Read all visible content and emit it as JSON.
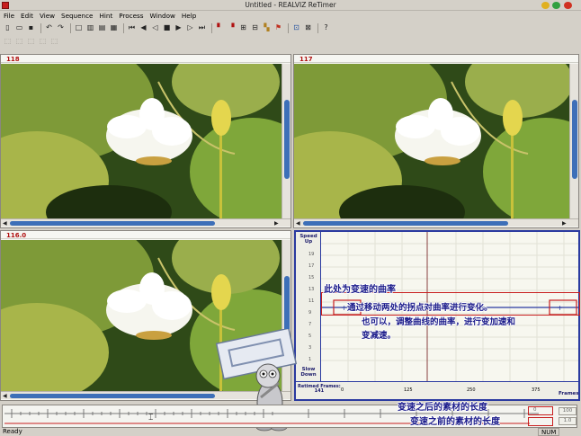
{
  "window": {
    "title": "Untitled - REALVIZ ReTimer"
  },
  "menu": [
    "File",
    "Edit",
    "View",
    "Sequence",
    "Hint",
    "Process",
    "Window",
    "Help"
  ],
  "panes": {
    "top_left": {
      "frame": "118"
    },
    "top_right": {
      "frame": "117"
    },
    "bottom_left": {
      "frame": "116.0"
    }
  },
  "graph": {
    "speed_up": "Speed Up",
    "slow_down": "Slow Down",
    "retimed_frames_label": "Retimed Frames:",
    "retimed_frames_value": "141",
    "frames_label": "Frames",
    "y_ticks": [
      "19",
      "17",
      "15",
      "13",
      "11",
      "9",
      "7",
      "5",
      "3",
      "1"
    ],
    "x_ticks": [
      "0",
      "125",
      "250",
      "375"
    ]
  },
  "annotations": {
    "speed_note": "此处为变速的曲率",
    "drag_note_1": "通过移动两处的拐点对曲率进行变化。",
    "drag_note_2": "也可以，调整曲线的曲率，进行变加速和",
    "drag_note_3": "变减速。",
    "length_after": "变速之后的素材的长度",
    "length_before": "变速之前的素材的长度"
  },
  "timeline": {
    "field_1": "0",
    "field_2": "100",
    "field_3": "1.0"
  },
  "statusbar": {
    "left": "Ready",
    "num": "NUM"
  },
  "colors": {
    "accent": "#3d6fb8",
    "annotation_box": "#c81e1e",
    "graph_border": "#2a3aa0"
  }
}
